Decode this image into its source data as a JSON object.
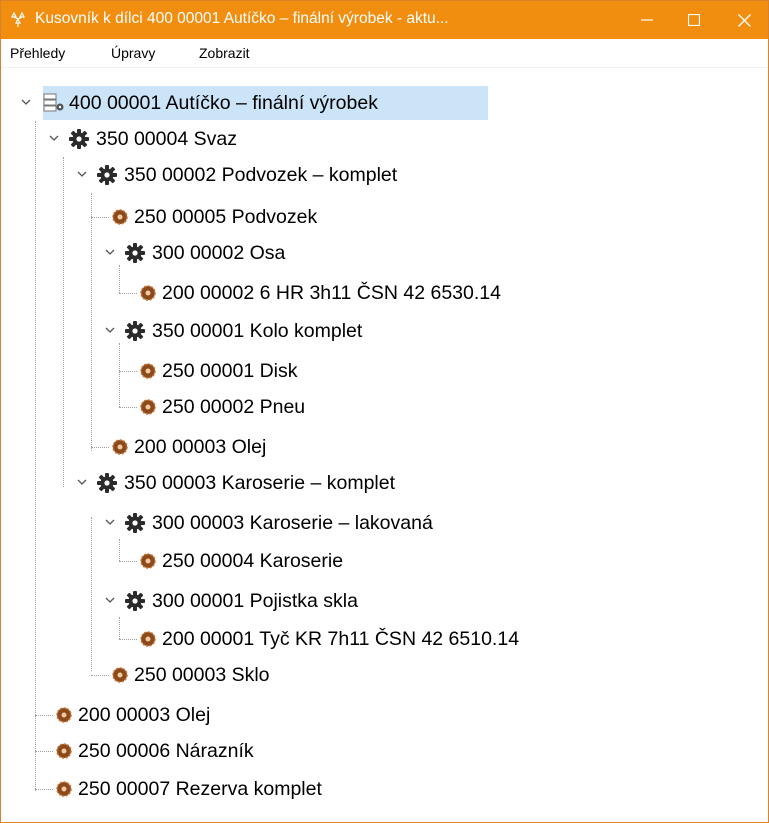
{
  "window": {
    "title": "Kusovník k dílci 400 00001 Autíčko – finální výrobek - aktu...",
    "accent_color": "#f18e0f",
    "buttons": [
      "minimize-icon",
      "maximize-icon",
      "close-icon"
    ]
  },
  "menu": {
    "items": [
      "Přehledy",
      "Úpravy",
      "Zobrazit"
    ]
  },
  "tree": {
    "selected": "400 00001 Autíčko – finální výrobek",
    "nodes": [
      {
        "label": "400 00001 Autíčko – finální výrobek",
        "icon": "product-icon",
        "expanded": true
      },
      {
        "label": "350 00004 Svaz",
        "icon": "assembly-gear-icon",
        "expanded": true
      },
      {
        "label": "350 00002 Podvozek – komplet",
        "icon": "assembly-gear-icon",
        "expanded": true
      },
      {
        "label": "250 00005 Podvozek",
        "icon": "part-icon"
      },
      {
        "label": "300 00002 Osa",
        "icon": "assembly-gear-icon",
        "expanded": true
      },
      {
        "label": "200 00002 6 HR 3h11 ČSN 42 6530.14",
        "icon": "part-icon"
      },
      {
        "label": "350 00001 Kolo komplet",
        "icon": "assembly-gear-icon",
        "expanded": true
      },
      {
        "label": "250 00001 Disk",
        "icon": "part-icon"
      },
      {
        "label": "250 00002 Pneu",
        "icon": "part-icon"
      },
      {
        "label": "200 00003 Olej",
        "icon": "part-icon"
      },
      {
        "label": "350 00003 Karoserie – komplet",
        "icon": "assembly-gear-icon",
        "expanded": true
      },
      {
        "label": "300 00003 Karoserie – lakovaná",
        "icon": "assembly-gear-icon",
        "expanded": true
      },
      {
        "label": "250 00004 Karoserie",
        "icon": "part-icon"
      },
      {
        "label": "300 00001 Pojistka skla",
        "icon": "assembly-gear-icon",
        "expanded": true
      },
      {
        "label": "200 00001 Tyč KR 7h11 ČSN 42 6510.14",
        "icon": "part-icon"
      },
      {
        "label": "250 00003 Sklo",
        "icon": "part-icon"
      },
      {
        "label": "200 00003 Olej",
        "icon": "part-icon"
      },
      {
        "label": "250 00006 Nárazník",
        "icon": "part-icon"
      },
      {
        "label": "250 00007 Rezerva komplet",
        "icon": "part-icon"
      }
    ]
  }
}
